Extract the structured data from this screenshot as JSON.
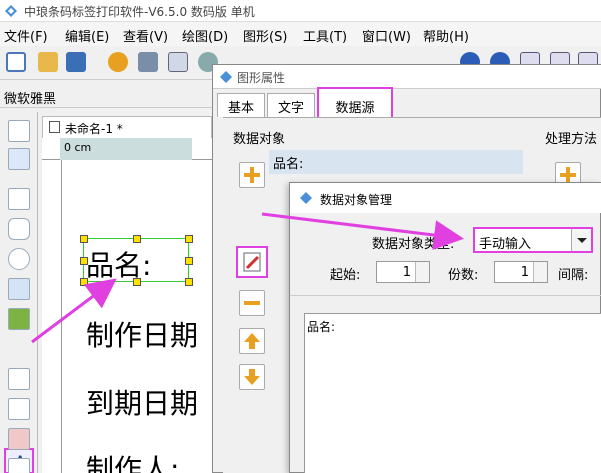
{
  "window": {
    "title": "中琅条码标签打印软件-V6.5.0 数码版 单机"
  },
  "menu": [
    "文件(F)",
    "编辑(E)",
    "查看(V)",
    "绘图(D)",
    "图形(S)",
    "工具(T)",
    "窗口(W)",
    "帮助(H)"
  ],
  "fontbar": {
    "font_name": "微软雅黑"
  },
  "doc": {
    "tab_label": "未命名-1 *",
    "ruler_label": "0 cm"
  },
  "canvas": {
    "labels": [
      "品名:",
      "制作日期",
      "到期日期",
      "制作人:"
    ]
  },
  "props_dialog": {
    "title": "图形属性",
    "tabs": [
      "基本",
      "文字",
      "数据源"
    ],
    "data_objects_label": "数据对象",
    "method_label": "处理方法",
    "list_item": "品名:"
  },
  "dm_dialog": {
    "title": "数据对象管理",
    "type_label": "数据对象类型:",
    "type_value": "手动输入",
    "start_label": "起始:",
    "start_value": "1",
    "copies_label": "份数:",
    "copies_value": "1",
    "interval_label": "间隔:",
    "content": "品名:"
  },
  "colors": {
    "highlight": "#e040e0",
    "selection": "#33cc33",
    "handle": "#ffe000"
  }
}
